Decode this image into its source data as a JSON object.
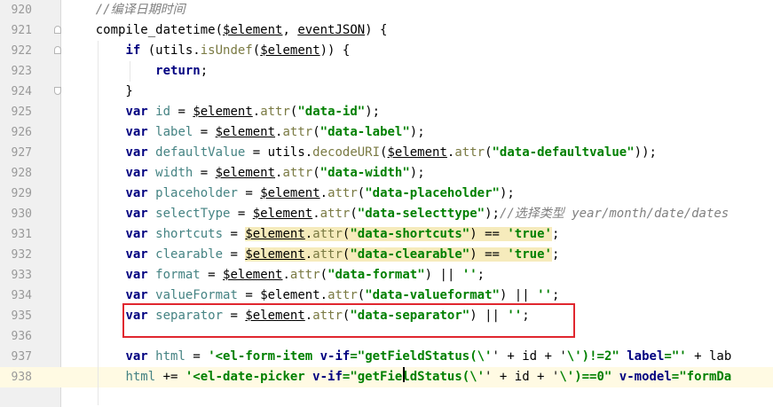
{
  "editor": {
    "lines": [
      {
        "num": "920",
        "tokens": [
          [
            "cmt",
            "    //编译日期时间"
          ]
        ]
      },
      {
        "num": "921",
        "tokens": [
          [
            "fn",
            "    "
          ],
          [
            "fn",
            "compile_datetime"
          ],
          [
            "fn",
            "("
          ],
          [
            "dl",
            "$element"
          ],
          [
            "fn",
            ", "
          ],
          [
            "dl",
            "eventJSON"
          ],
          [
            "fn",
            ") {"
          ]
        ]
      },
      {
        "num": "922",
        "tokens": [
          [
            "fn",
            "        "
          ],
          [
            "kw",
            "if"
          ],
          [
            "fn",
            " (utils."
          ],
          [
            "mt",
            "isUndef"
          ],
          [
            "fn",
            "("
          ],
          [
            "dl",
            "$element"
          ],
          [
            "fn",
            ")) {"
          ]
        ]
      },
      {
        "num": "923",
        "tokens": [
          [
            "fn",
            "            "
          ],
          [
            "kw",
            "return"
          ],
          [
            "fn",
            ";"
          ]
        ]
      },
      {
        "num": "924",
        "tokens": [
          [
            "fn",
            "        }"
          ]
        ]
      },
      {
        "num": "925",
        "tokens": [
          [
            "fn",
            "        "
          ],
          [
            "kw",
            "var"
          ],
          [
            "vr",
            " id"
          ],
          [
            "fn",
            " = "
          ],
          [
            "dl",
            "$element"
          ],
          [
            "fn",
            "."
          ],
          [
            "mt",
            "attr"
          ],
          [
            "fn",
            "("
          ],
          [
            "st",
            "\"data-id\""
          ],
          [
            "fn",
            ");"
          ]
        ]
      },
      {
        "num": "926",
        "tokens": [
          [
            "fn",
            "        "
          ],
          [
            "kw",
            "var"
          ],
          [
            "vr",
            " label"
          ],
          [
            "fn",
            " = "
          ],
          [
            "dl",
            "$element"
          ],
          [
            "fn",
            "."
          ],
          [
            "mt",
            "attr"
          ],
          [
            "fn",
            "("
          ],
          [
            "st",
            "\"data-label\""
          ],
          [
            "fn",
            ");"
          ]
        ]
      },
      {
        "num": "927",
        "tokens": [
          [
            "fn",
            "        "
          ],
          [
            "kw",
            "var"
          ],
          [
            "vr",
            " defaultValue"
          ],
          [
            "fn",
            " = utils."
          ],
          [
            "mt",
            "decodeURI"
          ],
          [
            "fn",
            "("
          ],
          [
            "dl",
            "$element"
          ],
          [
            "fn",
            "."
          ],
          [
            "mt",
            "attr"
          ],
          [
            "fn",
            "("
          ],
          [
            "st",
            "\"data-defaultvalue\""
          ],
          [
            "fn",
            "));"
          ]
        ]
      },
      {
        "num": "928",
        "tokens": [
          [
            "fn",
            "        "
          ],
          [
            "kw",
            "var"
          ],
          [
            "vr",
            " width"
          ],
          [
            "fn",
            " = "
          ],
          [
            "dl",
            "$element"
          ],
          [
            "fn",
            "."
          ],
          [
            "mt",
            "attr"
          ],
          [
            "fn",
            "("
          ],
          [
            "st",
            "\"data-width\""
          ],
          [
            "fn",
            ");"
          ]
        ]
      },
      {
        "num": "929",
        "tokens": [
          [
            "fn",
            "        "
          ],
          [
            "kw",
            "var"
          ],
          [
            "vr",
            " placeholder"
          ],
          [
            "fn",
            " = "
          ],
          [
            "dl",
            "$element"
          ],
          [
            "fn",
            "."
          ],
          [
            "mt",
            "attr"
          ],
          [
            "fn",
            "("
          ],
          [
            "st",
            "\"data-placeholder\""
          ],
          [
            "fn",
            ");"
          ]
        ]
      },
      {
        "num": "930",
        "tokens": [
          [
            "fn",
            "        "
          ],
          [
            "kw",
            "var"
          ],
          [
            "vr",
            " selectType"
          ],
          [
            "fn",
            " = "
          ],
          [
            "dl",
            "$element"
          ],
          [
            "fn",
            "."
          ],
          [
            "mt",
            "attr"
          ],
          [
            "fn",
            "("
          ],
          [
            "st",
            "\"data-selecttype\""
          ],
          [
            "fn",
            ");"
          ],
          [
            "cmt",
            "//选择类型 year/month/date/dates"
          ]
        ]
      },
      {
        "num": "931",
        "tokens": [
          [
            "fn",
            "        "
          ],
          [
            "kw",
            "var"
          ],
          [
            "vr",
            " shortcuts"
          ],
          [
            "fn",
            " = "
          ],
          [
            "dl hl",
            "$element"
          ],
          [
            "fn hl",
            "."
          ],
          [
            "mt hl",
            "attr"
          ],
          [
            "fn hl",
            "("
          ],
          [
            "st hl",
            "\"data-shortcuts\""
          ],
          [
            "fn hl",
            ") == "
          ],
          [
            "sq hl",
            "'true'"
          ],
          [
            "fn",
            ";"
          ]
        ]
      },
      {
        "num": "932",
        "tokens": [
          [
            "fn",
            "        "
          ],
          [
            "kw",
            "var"
          ],
          [
            "vr",
            " clearable"
          ],
          [
            "fn",
            " = "
          ],
          [
            "dl hl",
            "$element"
          ],
          [
            "fn hl",
            "."
          ],
          [
            "mt hl",
            "attr"
          ],
          [
            "fn hl",
            "("
          ],
          [
            "st hl",
            "\"data-clearable\""
          ],
          [
            "fn hl",
            ") == "
          ],
          [
            "sq hl",
            "'true'"
          ],
          [
            "fn",
            ";"
          ]
        ]
      },
      {
        "num": "933",
        "tokens": [
          [
            "fn",
            "        "
          ],
          [
            "kw",
            "var"
          ],
          [
            "vr",
            " format"
          ],
          [
            "fn",
            " = "
          ],
          [
            "dl",
            "$element"
          ],
          [
            "fn",
            "."
          ],
          [
            "mt",
            "attr"
          ],
          [
            "fn",
            "("
          ],
          [
            "st",
            "\"data-format\""
          ],
          [
            "fn",
            ") || "
          ],
          [
            "sq",
            "''"
          ],
          [
            "fn",
            ";"
          ]
        ]
      },
      {
        "num": "934",
        "tokens": [
          [
            "fn",
            "        "
          ],
          [
            "kw",
            "var"
          ],
          [
            "vr",
            " valueFormat"
          ],
          [
            "fn",
            " = "
          ],
          [
            "fn",
            "$element"
          ],
          [
            "fn",
            "."
          ],
          [
            "mt",
            "attr"
          ],
          [
            "fn",
            "("
          ],
          [
            "st",
            "\"data-valueformat\""
          ],
          [
            "fn",
            ") || "
          ],
          [
            "sq",
            "''"
          ],
          [
            "fn",
            ";"
          ]
        ]
      },
      {
        "num": "935",
        "tokens": [
          [
            "fn",
            "        "
          ],
          [
            "kw",
            "var"
          ],
          [
            "vr",
            " separator"
          ],
          [
            "fn",
            " = "
          ],
          [
            "dl",
            "$element"
          ],
          [
            "fn",
            "."
          ],
          [
            "mt",
            "attr"
          ],
          [
            "fn",
            "("
          ],
          [
            "st",
            "\"data-separator\""
          ],
          [
            "fn",
            ") || "
          ],
          [
            "sq",
            "''"
          ],
          [
            "fn",
            ";"
          ]
        ]
      },
      {
        "num": "936",
        "tokens": []
      },
      {
        "num": "937",
        "tokens": [
          [
            "fn",
            "        "
          ],
          [
            "kw",
            "var"
          ],
          [
            "vr",
            " html"
          ],
          [
            "fn",
            " = "
          ],
          [
            "sq",
            "'<el-form-item "
          ],
          [
            "kw",
            "v-if"
          ],
          [
            "st",
            "=\"getFieldStatus(\\'"
          ],
          [
            "fn",
            "' + id + '"
          ],
          [
            "st",
            "\\')!=2\""
          ],
          [
            "kw",
            " label"
          ],
          [
            "st",
            "=\"'"
          ],
          [
            "fn",
            " + lab"
          ]
        ]
      },
      {
        "num": "938",
        "tokens": [
          [
            "fn",
            "        "
          ],
          [
            "vr",
            "html"
          ],
          [
            "fn",
            " += "
          ],
          [
            "sq",
            "'<el-date-picker "
          ],
          [
            "kw",
            "v-if"
          ],
          [
            "st",
            "=\"getFieldStatus(\\'"
          ],
          [
            "fn",
            "' + id + '"
          ],
          [
            "st",
            "\\')==0\""
          ],
          [
            "kw",
            " v-model"
          ],
          [
            "st",
            "=\"formDa"
          ]
        ]
      }
    ]
  },
  "colors": {
    "keyword": "#000080",
    "string": "#008000",
    "comment": "#808080",
    "highlight_box": "#e0272f"
  }
}
